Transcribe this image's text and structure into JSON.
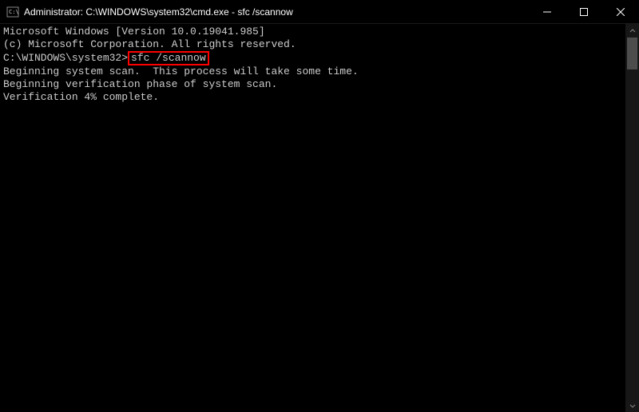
{
  "titlebar": {
    "title": "Administrator: C:\\WINDOWS\\system32\\cmd.exe - sfc  /scannow"
  },
  "terminal": {
    "line1": "Microsoft Windows [Version 10.0.19041.985]",
    "line2": "(c) Microsoft Corporation. All rights reserved.",
    "blank1": "",
    "prompt": "C:\\WINDOWS\\system32>",
    "command": "sfc /scannow",
    "blank2": "",
    "line3": "Beginning system scan.  This process will take some time.",
    "blank3": "",
    "line4": "Beginning verification phase of system scan.",
    "line5": "Verification 4% complete."
  }
}
